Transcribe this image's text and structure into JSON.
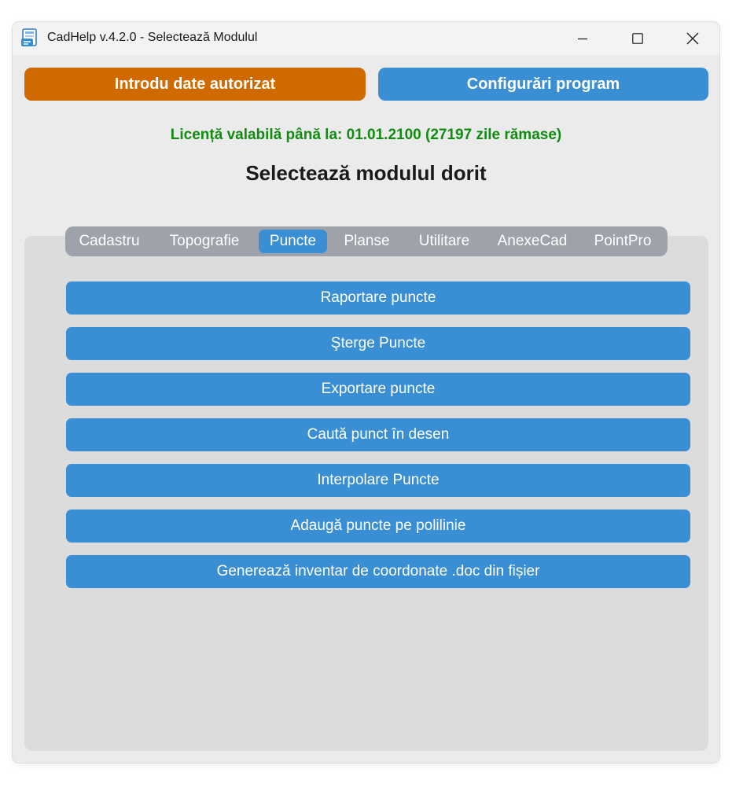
{
  "window": {
    "title": "CadHelp v.4.2.0 - Selectează Modulul",
    "app_icon": "cadhelp-app-icon",
    "controls": {
      "minimize_icon": "minimize-icon",
      "maximize_icon": "maximize-icon",
      "close_icon": "close-icon"
    }
  },
  "header": {
    "auth_button_label": "Introdu date autorizat",
    "config_button_label": "Configurări program",
    "license_text": "Licență valabilă până la: 01.01.2100 (27197 zile rămase)",
    "heading": "Selectează modulul dorit"
  },
  "tabs": [
    {
      "label": "Cadastru",
      "selected": false
    },
    {
      "label": "Topografie",
      "selected": false
    },
    {
      "label": "Puncte",
      "selected": true
    },
    {
      "label": "Planse",
      "selected": false
    },
    {
      "label": "Utilitare",
      "selected": false
    },
    {
      "label": "AnexeCad",
      "selected": false
    },
    {
      "label": "PointPro",
      "selected": false
    }
  ],
  "modules": [
    {
      "label": "Raportare puncte"
    },
    {
      "label": "Şterge Puncte"
    },
    {
      "label": "Exportare puncte"
    },
    {
      "label": "Caută punct în desen"
    },
    {
      "label": "Interpolare Puncte"
    },
    {
      "label": "Adaugă puncte pe polilinie"
    },
    {
      "label": "Generează inventar de coordonate .doc din fișier"
    }
  ],
  "colors": {
    "window_bg": "#ebebeb",
    "titlebar_bg": "#f3f3f3",
    "auth_button": "#d06a00",
    "primary_blue": "#3a8fd4",
    "license_text": "#118b11",
    "panel_bg": "#dcdcdc",
    "tabbar_bg": "#9ea3ab"
  }
}
